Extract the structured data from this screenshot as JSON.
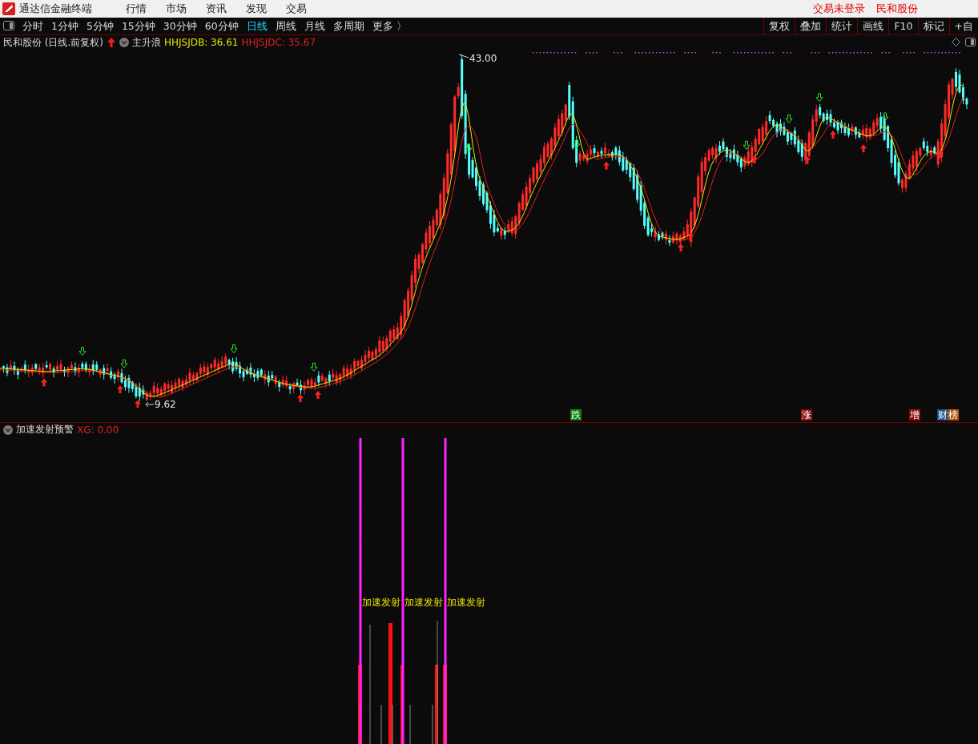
{
  "menu_bar": {
    "app_title": "通达信金融终端",
    "menus": [
      "行情",
      "市场",
      "资讯",
      "发现",
      "交易"
    ],
    "status": "交易未登录",
    "stock": "民和股份"
  },
  "toolbar": {
    "periods": [
      {
        "label": "分时",
        "selected": false
      },
      {
        "label": "1分钟",
        "selected": false
      },
      {
        "label": "5分钟",
        "selected": false
      },
      {
        "label": "15分钟",
        "selected": false
      },
      {
        "label": "30分钟",
        "selected": false
      },
      {
        "label": "60分钟",
        "selected": false
      },
      {
        "label": "日线",
        "selected": true
      },
      {
        "label": "周线",
        "selected": false
      },
      {
        "label": "月线",
        "selected": false
      },
      {
        "label": "多周期",
        "selected": false
      }
    ],
    "more": "更多 〉",
    "tools": [
      "复权",
      "叠加",
      "统计",
      "画线",
      "F10",
      "标记",
      "+自"
    ]
  },
  "main_chart": {
    "title": "民和股份 (日线.前复权)",
    "indicator": "主升浪",
    "values": [
      {
        "label": "HHJSJDB: 36.61",
        "color": "#e6e600"
      },
      {
        "label": "HHJSJDC: 35.67",
        "color": "#e02020"
      }
    ],
    "high_label": "43.00",
    "low_label": "9.62",
    "event_tags": [
      {
        "label": "跌",
        "color": "#0a7d0a"
      },
      {
        "label": "涨",
        "color": "#8b0a0a"
      },
      {
        "label": "增",
        "color": "#8b0a0a"
      },
      {
        "label": "财",
        "color": "#1c4f8c"
      },
      {
        "label": "榜",
        "color": "#a8520e"
      }
    ]
  },
  "sub_chart": {
    "title": "加速发射预警",
    "value": "XG: 0.00",
    "signals": [
      {
        "label": "加速发射"
      },
      {
        "label": "加速发射"
      },
      {
        "label": "加速发射"
      }
    ]
  }
}
